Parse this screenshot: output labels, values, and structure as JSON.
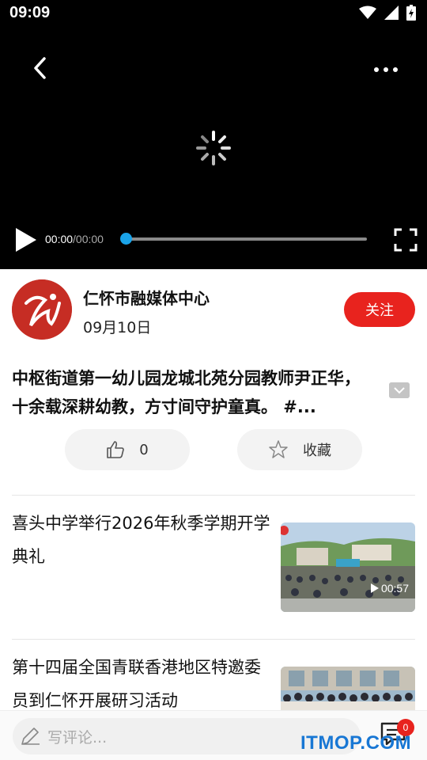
{
  "status_bar": {
    "time": "09:09"
  },
  "video": {
    "current_time": "00:00",
    "total_time": "/00:00",
    "progress": 0
  },
  "publisher": {
    "name": "仁怀市融媒体中心",
    "date": "09月10日",
    "follow_label": "关注"
  },
  "article": {
    "title": "中枢街道第一幼儿园龙城北苑分园教师尹正华，十余载深耕幼教，方寸间守护童真。 #..."
  },
  "actions": {
    "like_count": "0",
    "favorite_label": "收藏"
  },
  "related": [
    {
      "title": "喜头中学举行2026年秋季学期开学典礼",
      "duration": "00:57"
    },
    {
      "title": "第十四届全国青联香港地区特邀委员到仁怀开展研习活动"
    }
  ],
  "comment_bar": {
    "placeholder": "写评论...",
    "badge_count": "0"
  },
  "watermark": "ITMOP.COM",
  "colors": {
    "accent": "#e8231e",
    "progress": "#1aa3e8"
  }
}
